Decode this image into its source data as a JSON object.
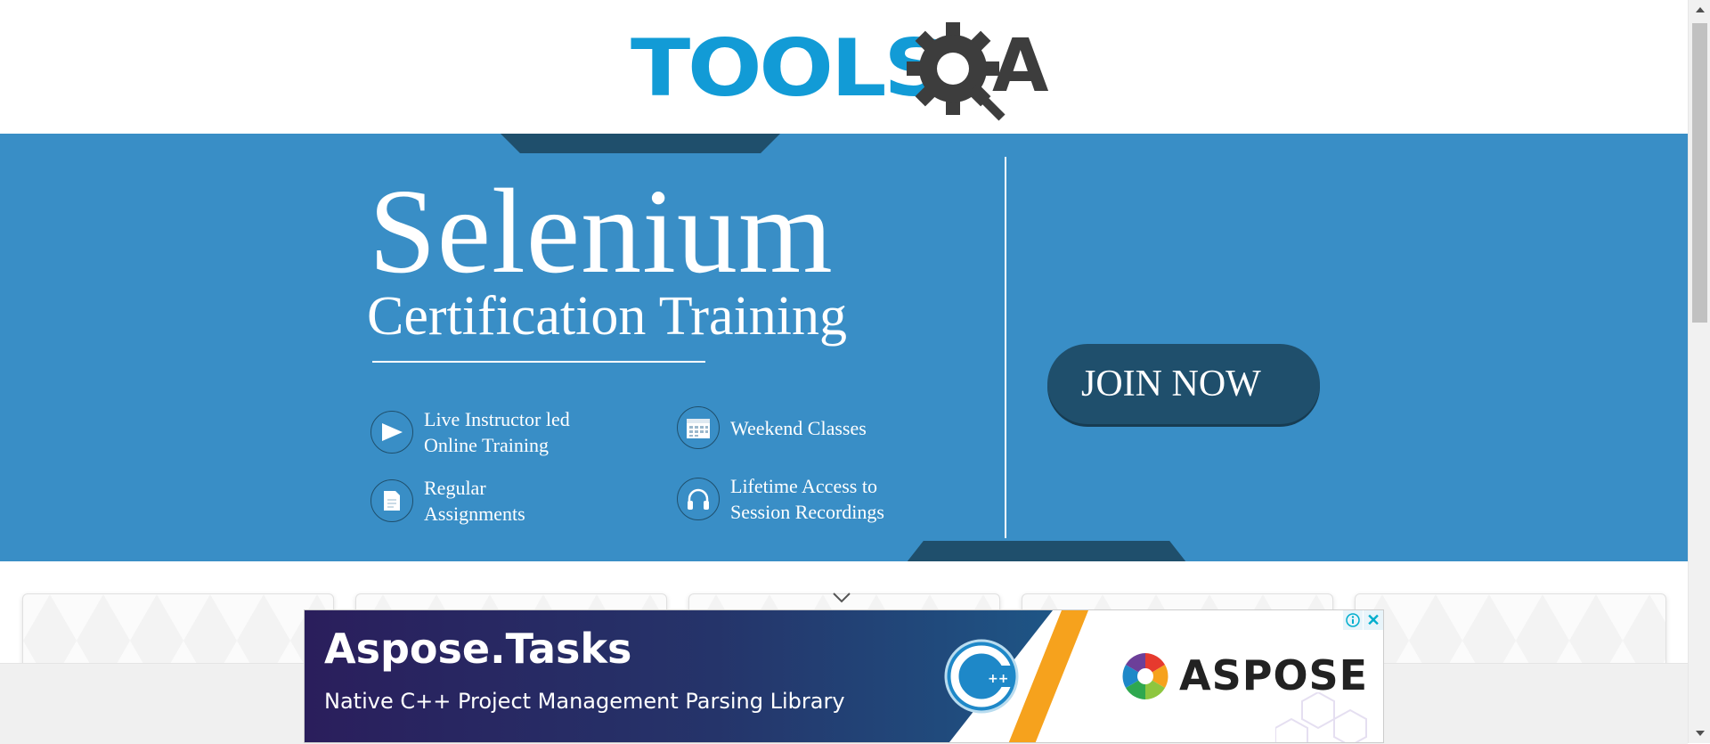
{
  "header": {
    "logo_text": "TOOLSQA",
    "logo_text_tools": "TOOLS",
    "logo_text_a": "A",
    "logo_color": "#129bd6"
  },
  "banner": {
    "background": "#398ec6",
    "title": "Selenium",
    "subtitle": "Certification Training",
    "features": [
      {
        "icon": "play-icon",
        "line1": "Live Instructor led",
        "line2": "Online Training"
      },
      {
        "icon": "calendar-icon",
        "line1": "Weekend Classes",
        "line2": ""
      },
      {
        "icon": "document-icon",
        "line1": "Regular",
        "line2": "Assignments"
      },
      {
        "icon": "headphones-icon",
        "line1": "Lifetime Access to",
        "line2": "Session Recordings"
      }
    ],
    "cta_label": "JOIN NOW"
  },
  "cards": {
    "count": 5
  },
  "ad": {
    "title": "Aspose.Tasks",
    "subtitle": "Native C++ Project Management Parsing Library",
    "brand": "ASPOSE",
    "badge": "C++",
    "info_icon": "info-icon",
    "close_label": "✕"
  }
}
